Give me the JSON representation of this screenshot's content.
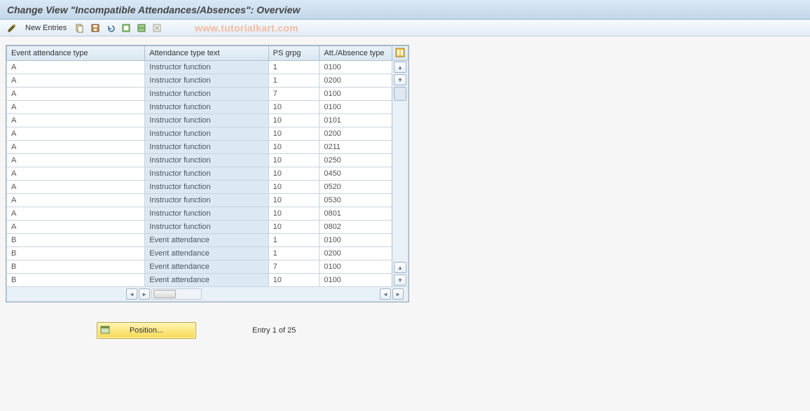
{
  "header": {
    "title": "Change View \"Incompatible Attendances/Absences\": Overview"
  },
  "toolbar": {
    "new_entries_label": "New Entries",
    "watermark": "www.tutorialkart.com"
  },
  "table": {
    "headers": {
      "event_type": "Event attendance type",
      "att_text": "Attendance type text",
      "ps_grp": "PS grpg",
      "abs_type": "Att./Absence type"
    },
    "rows": [
      {
        "event_type": "A",
        "att_text": "Instructor function",
        "ps_grp": "1",
        "abs_type": "0100"
      },
      {
        "event_type": "A",
        "att_text": "Instructor function",
        "ps_grp": "1",
        "abs_type": "0200"
      },
      {
        "event_type": "A",
        "att_text": "Instructor function",
        "ps_grp": "7",
        "abs_type": "0100"
      },
      {
        "event_type": "A",
        "att_text": "Instructor function",
        "ps_grp": "10",
        "abs_type": "0100"
      },
      {
        "event_type": "A",
        "att_text": "Instructor function",
        "ps_grp": "10",
        "abs_type": "0101"
      },
      {
        "event_type": "A",
        "att_text": "Instructor function",
        "ps_grp": "10",
        "abs_type": "0200"
      },
      {
        "event_type": "A",
        "att_text": "Instructor function",
        "ps_grp": "10",
        "abs_type": "0211"
      },
      {
        "event_type": "A",
        "att_text": "Instructor function",
        "ps_grp": "10",
        "abs_type": "0250"
      },
      {
        "event_type": "A",
        "att_text": "Instructor function",
        "ps_grp": "10",
        "abs_type": "0450"
      },
      {
        "event_type": "A",
        "att_text": "Instructor function",
        "ps_grp": "10",
        "abs_type": "0520"
      },
      {
        "event_type": "A",
        "att_text": "Instructor function",
        "ps_grp": "10",
        "abs_type": "0530"
      },
      {
        "event_type": "A",
        "att_text": "Instructor function",
        "ps_grp": "10",
        "abs_type": "0801"
      },
      {
        "event_type": "A",
        "att_text": "Instructor function",
        "ps_grp": "10",
        "abs_type": "0802"
      },
      {
        "event_type": "B",
        "att_text": "Event attendance",
        "ps_grp": "1",
        "abs_type": "0100"
      },
      {
        "event_type": "B",
        "att_text": "Event attendance",
        "ps_grp": "1",
        "abs_type": "0200"
      },
      {
        "event_type": "B",
        "att_text": "Event attendance",
        "ps_grp": "7",
        "abs_type": "0100"
      },
      {
        "event_type": "B",
        "att_text": "Event attendance",
        "ps_grp": "10",
        "abs_type": "0100"
      }
    ]
  },
  "footer": {
    "position_label": "Position...",
    "entry_text": "Entry 1 of 25"
  }
}
